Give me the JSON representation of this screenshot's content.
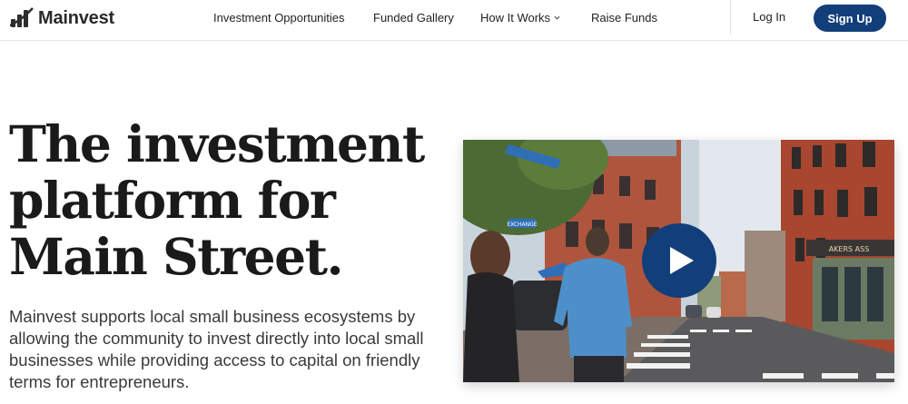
{
  "brand": {
    "name": "Mainvest",
    "logo_icon": "bars-logo-icon",
    "accent_color": "#123e7a"
  },
  "nav": {
    "items": [
      {
        "label": "Investment Opportunities"
      },
      {
        "label": "Funded Gallery"
      },
      {
        "label": "How It Works",
        "icon": "chevron-down-icon"
      },
      {
        "label": "Raise Funds"
      }
    ],
    "login_label": "Log In",
    "signup_label": "Sign Up"
  },
  "hero": {
    "headline_lines": [
      "The investment",
      "platform for",
      "Main Street."
    ],
    "subtext": "Mainvest supports local small business ecosystems by allowing the community to invest directly into local small businesses while providing access to capital on friendly terms for entrepreneurs."
  },
  "video": {
    "play_icon": "play-icon",
    "street_sign": "EXCHANGE",
    "shop_sign": "AKERS ASS"
  }
}
